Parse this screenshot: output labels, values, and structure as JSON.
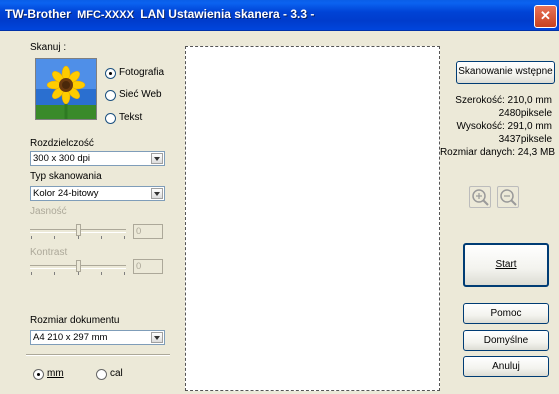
{
  "window": {
    "title_prefix": "TW-Brother",
    "title_model": "MFC-XXXX",
    "title_suffix": "LAN Ustawienia skanera - 3.3 -",
    "close_label": "✕"
  },
  "scan_type": {
    "label": "Skanuj :",
    "options": [
      "Fotografia",
      "Sieć Web",
      "Tekst"
    ],
    "selected": "Fotografia"
  },
  "resolution": {
    "label": "Rozdzielczość",
    "value": "300 x 300 dpi"
  },
  "scan_mode": {
    "label": "Typ skanowania",
    "value": "Kolor 24-bitowy"
  },
  "brightness": {
    "label": "Jasność",
    "value": "0",
    "enabled": false
  },
  "contrast": {
    "label": "Kontrast",
    "value": "0",
    "enabled": false
  },
  "document_size": {
    "label": "Rozmiar dokumentu",
    "value": "A4 210 x 297 mm"
  },
  "units": {
    "options": [
      "mm",
      "cal"
    ],
    "selected": "mm"
  },
  "prescan_button": "Skanowanie wstępne",
  "scan_info": {
    "width_label": "Szerokość:",
    "width_mm": "210,0 mm",
    "width_px": "2480piksele",
    "height_label": "Wysokość:",
    "height_mm": "291,0 mm",
    "height_px": "3437piksele",
    "size_label": "Rozmiar danych:",
    "size_value": "24,3 MB"
  },
  "zoom": {
    "in_icon": "zoom-in-icon",
    "out_icon": "zoom-out-icon"
  },
  "buttons": {
    "start": "Start",
    "help": "Pomoc",
    "defaults": "Domyślne",
    "cancel": "Anuluj"
  },
  "colors": {
    "titlebar": "#0043d6",
    "dialog_bg": "#ece9d8",
    "close": "#c7411f",
    "button_border": "#003c74"
  }
}
